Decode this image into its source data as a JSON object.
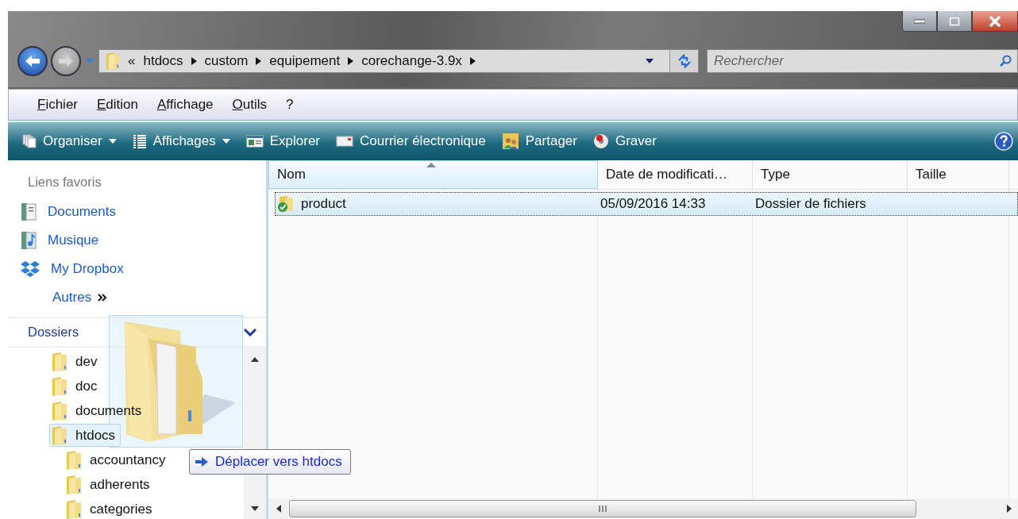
{
  "address_bar": {
    "overflow": "«",
    "crumbs": [
      "htdocs",
      "custom",
      "equipement",
      "corechange-3.9x"
    ]
  },
  "search": {
    "placeholder": "Rechercher"
  },
  "menu_bar": [
    "Fichier",
    "Edition",
    "Affichage",
    "Outils",
    "?"
  ],
  "toolbar": [
    {
      "label": "Organiser",
      "kind": "organise",
      "dropdown": true
    },
    {
      "label": "Affichages",
      "kind": "views",
      "dropdown": true
    },
    {
      "label": "Explorer",
      "kind": "explorer",
      "dropdown": false
    },
    {
      "label": "Courrier électronique",
      "kind": "mail",
      "dropdown": false
    },
    {
      "label": "Partager",
      "kind": "share",
      "dropdown": false
    },
    {
      "label": "Graver",
      "kind": "burn",
      "dropdown": false
    }
  ],
  "favorites": {
    "title": "Liens favoris",
    "items": [
      {
        "label": "Documents",
        "kind": "documents"
      },
      {
        "label": "Musique",
        "kind": "music"
      },
      {
        "label": "My Dropbox",
        "kind": "dropbox"
      }
    ],
    "more": "Autres"
  },
  "folders": {
    "title": "Dossiers",
    "tree": [
      {
        "label": "dev",
        "selected": false
      },
      {
        "label": "doc",
        "selected": false
      },
      {
        "label": "documents",
        "selected": false
      },
      {
        "label": "htdocs",
        "selected": true,
        "children": [
          {
            "label": "accountancy",
            "selected": false
          },
          {
            "label": "adherents",
            "selected": false
          },
          {
            "label": "categories",
            "selected": false
          }
        ]
      }
    ]
  },
  "columns": [
    {
      "label": "Nom",
      "sorted": true
    },
    {
      "label": "Date de modificati…",
      "sorted": false
    },
    {
      "label": "Type",
      "sorted": false
    },
    {
      "label": "Taille",
      "sorted": false
    }
  ],
  "rows": [
    {
      "name": "product",
      "modified": "05/09/2016 14:33",
      "type": "Dossier de fichiers",
      "selected": true
    }
  ],
  "drag": {
    "tooltip": "Déplacer vers htdocs"
  }
}
